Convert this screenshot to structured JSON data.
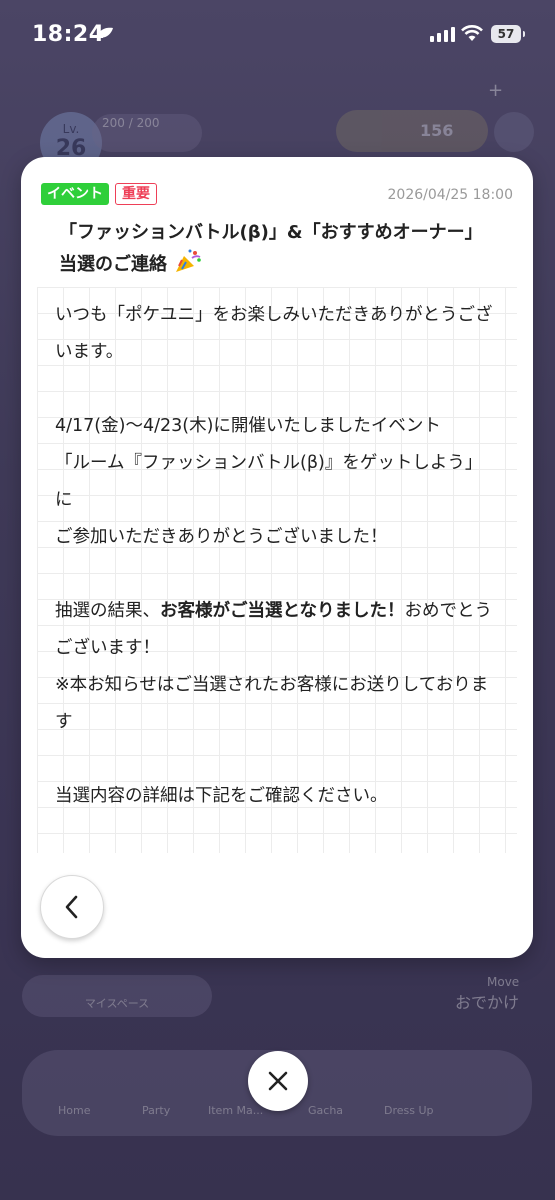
{
  "status_bar": {
    "time": "18:24",
    "battery": "57"
  },
  "background": {
    "level_label": "Lv.",
    "level_value": "26",
    "hp": "200 / 200",
    "coins": "156",
    "myspace_label": "マイスペース",
    "move_label": "Move",
    "odekake_label": "おでかけ",
    "nav": [
      "Home",
      "Party",
      "Item Ma...",
      "Gacha",
      "Dress Up"
    ]
  },
  "dialog": {
    "tag_event": "イベント",
    "tag_important": "重要",
    "date": "2026/04/25 18:00",
    "title": "「ファッションバトル(β)」&「おすすめオーナー」当選のご連絡",
    "body": {
      "p1": "いつも「ポケユニ」をお楽しみいただきありがとうございます。",
      "p2a": "4/17(金)〜4/23(木)に開催いたしましたイベント",
      "p2b": "「ルーム『ファッションバトル(β)』をゲットしよう」に",
      "p2c": "ご参加いただきありがとうございました！",
      "p3a_pre": "抽選の結果、",
      "p3a_bold": "お客様がご当選となりました！",
      "p3a_post": "おめでとうございます！",
      "p3b": "※本お知らせはご当選されたお客様にお送りしております",
      "p4": "当選内容の詳細は下記をご確認ください。"
    }
  },
  "icons": {
    "back": "chevron-left-icon",
    "close": "close-icon",
    "confetti": "party-popper-icon"
  },
  "colors": {
    "tag_event_bg": "#2fcf3a",
    "tag_important": "#ee3f57",
    "backdrop": "#3f3a58"
  }
}
